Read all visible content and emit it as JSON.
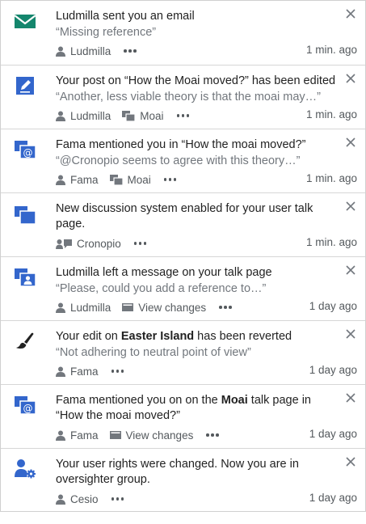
{
  "notifications": [
    {
      "icon": "envelope-icon",
      "title": "Ludmilla sent you an email",
      "excerpt": "“Missing reference”",
      "user": "Ludmilla",
      "time": "1 min. ago"
    },
    {
      "icon": "pencil-icon",
      "title": "Your post on “How the Moai moved?” has been edited",
      "excerpt": "“Another, less viable theory is that the moai may…”",
      "user": "Ludmilla",
      "page": "Moai",
      "time": "1 min. ago"
    },
    {
      "icon": "mention-icon",
      "title": "Fama mentioned you in “How the moai moved?”",
      "excerpt": "“@Cronopio seems to agree with this theory…”",
      "user": "Fama",
      "page": "Moai",
      "time": "1 min. ago"
    },
    {
      "icon": "discussion-icon",
      "title": "New discussion system enabled for your user talk page.",
      "user": "Cronopio",
      "time": "1 min. ago"
    },
    {
      "icon": "talk-message-icon",
      "title": "Ludmilla left a message on your talk page",
      "excerpt": "“Please, could you add a reference to…”",
      "user": "Ludmilla",
      "link": "View changes",
      "time": "1 day ago"
    },
    {
      "icon": "revert-brush-icon",
      "title_pre": "Your edit on ",
      "title_bold": "Easter Island",
      "title_post": " has been reverted",
      "excerpt": "“Not adhering to neutral point of view”",
      "user": "Fama",
      "time": "1 day ago"
    },
    {
      "icon": "mention-icon",
      "title_pre": "Fama mentioned you on on the ",
      "title_bold": "Moai",
      "title_post": " talk page in",
      "title_line2": "“How the moai moved?”",
      "user": "Fama",
      "link": "View changes",
      "time": "1 day ago"
    },
    {
      "icon": "user-rights-icon",
      "title": "Your user rights were changed. Now you are in",
      "title_line2": "oversighter group.",
      "user": "Cesio",
      "time": "1 day ago"
    }
  ],
  "colors": {
    "accent": "#36c",
    "envelope": "#14866d",
    "icon_dark": "#222222",
    "meta": "#54595d",
    "excerpt": "#72777d"
  }
}
